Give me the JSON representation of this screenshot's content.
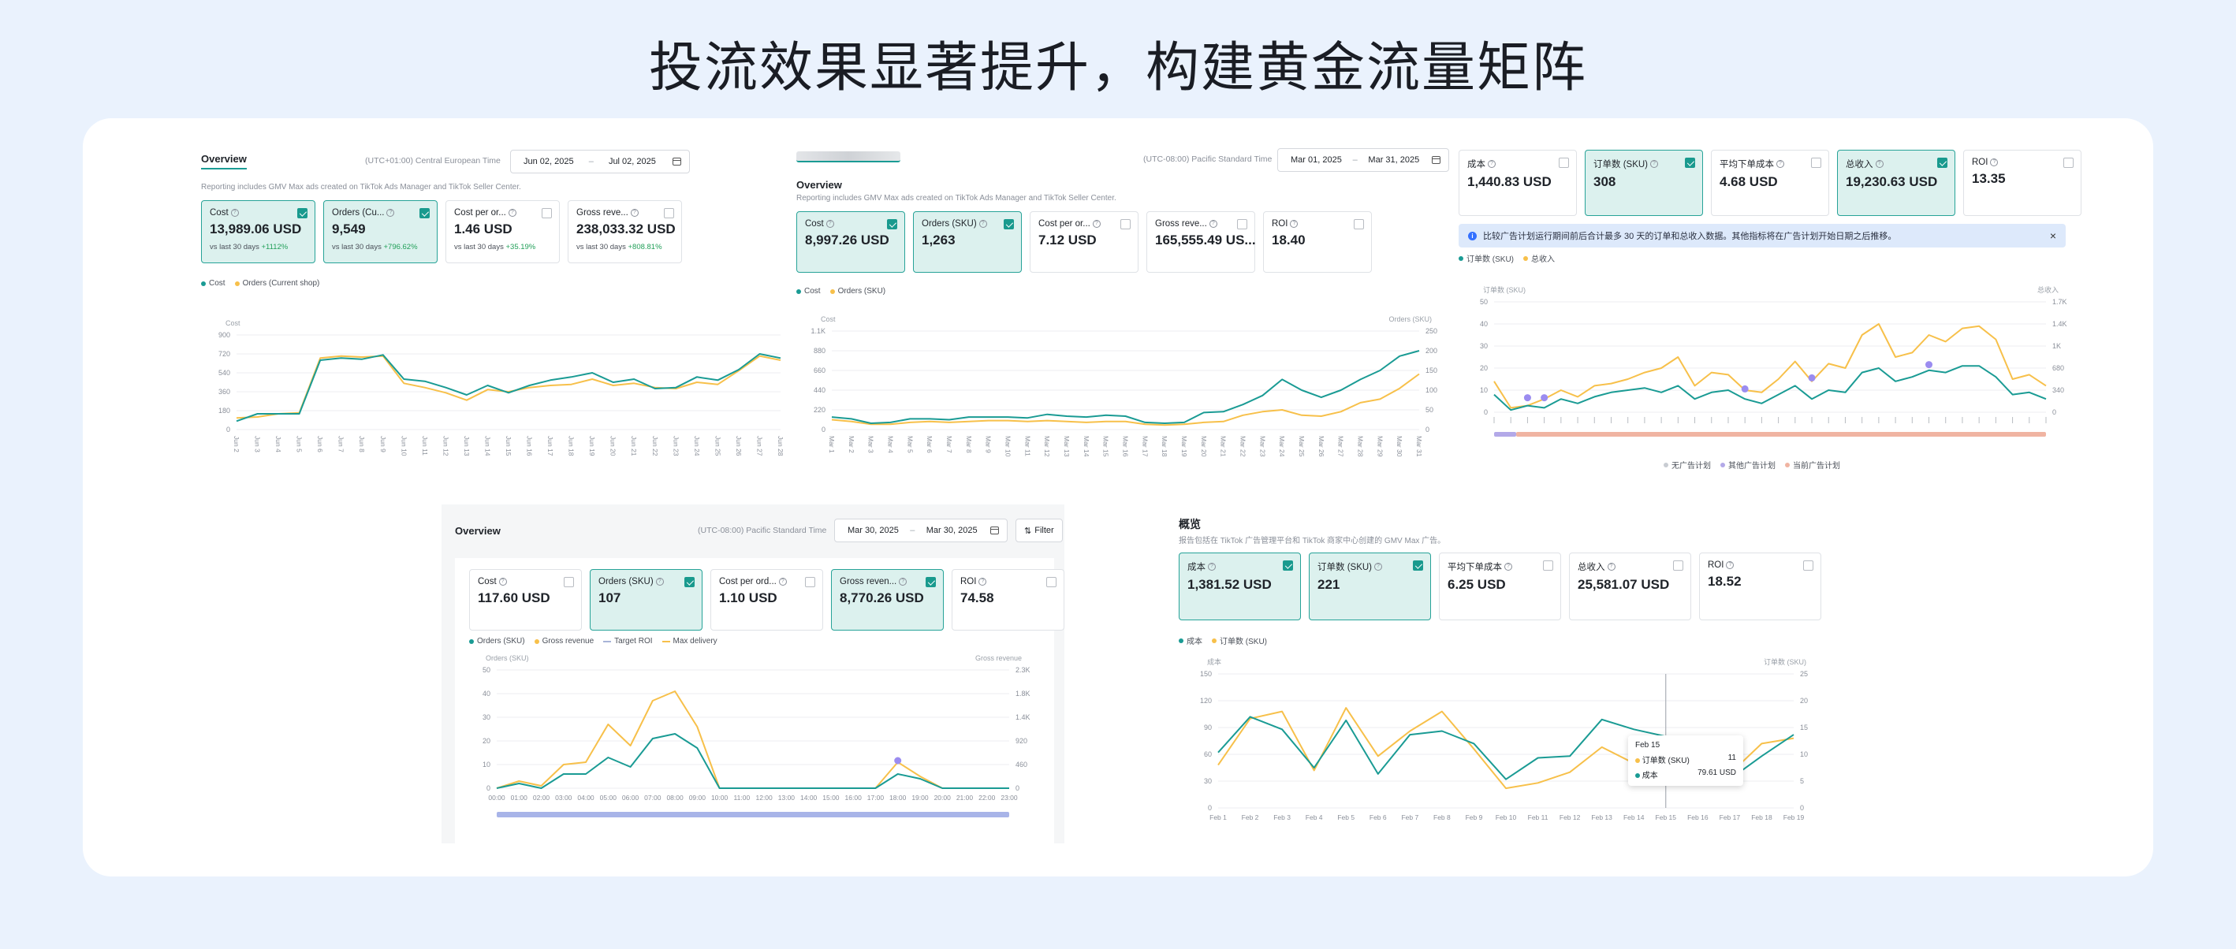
{
  "headline": "投流效果显著提升，构建黄金流量矩阵",
  "colors": {
    "teal": "#1a9b94",
    "orange": "#f7c04a",
    "selected_bg": "#dcf1ee",
    "page_bg": "#eaf2fd"
  },
  "panel1": {
    "tab": "Overview",
    "timezone": "(UTC+01:00) Central European Time",
    "date_start": "Jun 02, 2025",
    "date_end": "Jul 02, 2025",
    "note": "Reporting includes GMV Max ads created on TikTok Ads Manager and TikTok Seller Center.",
    "metrics": [
      {
        "label": "Cost",
        "value": "13,989.06 USD",
        "cmp": "vs last 30 days",
        "chg": "+1112%",
        "selected": true
      },
      {
        "label": "Orders (Cu...",
        "value": "9,549",
        "cmp": "vs last 30 days",
        "chg": "+796.62%",
        "selected": true
      },
      {
        "label": "Cost per or...",
        "value": "1.46 USD",
        "cmp": "vs last 30 days",
        "chg": "+35.19%",
        "selected": false
      },
      {
        "label": "Gross reve...",
        "value": "238,033.32 USD",
        "cmp": "vs last 30 days",
        "chg": "+808.81%",
        "selected": false
      }
    ],
    "legend": [
      "Cost",
      "Orders (Current shop)"
    ],
    "chart_data": {
      "type": "line",
      "ylabel": "Cost",
      "yticks": [
        "900",
        "720",
        "540",
        "360",
        "180",
        "0"
      ],
      "ylim": [
        0,
        900
      ],
      "x": [
        "Jun 2",
        "Jun 3",
        "Jun 4",
        "Jun 5",
        "Jun 6",
        "Jun 7",
        "Jun 8",
        "Jun 9",
        "Jun 10",
        "Jun 11",
        "Jun 12",
        "Jun 13",
        "Jun 14",
        "Jun 15",
        "Jun 16",
        "Jun 17",
        "Jun 18",
        "Jun 19",
        "Jun 20",
        "Jun 21",
        "Jun 22",
        "Jun 23",
        "Jun 24",
        "Jun 25",
        "Jun 26",
        "Jun 27",
        "Jun 28"
      ],
      "series": [
        {
          "name": "Cost",
          "color": "#1a9b94",
          "values": [
            80,
            150,
            150,
            150,
            660,
            680,
            670,
            710,
            480,
            460,
            400,
            330,
            420,
            350,
            420,
            470,
            500,
            540,
            450,
            480,
            390,
            400,
            500,
            470,
            570,
            720,
            680
          ]
        },
        {
          "name": "Orders (Current shop)",
          "color": "#f7c04a",
          "values": [
            110,
            120,
            150,
            160,
            680,
            700,
            690,
            700,
            440,
            400,
            350,
            280,
            380,
            360,
            400,
            420,
            430,
            480,
            420,
            440,
            400,
            390,
            450,
            430,
            560,
            700,
            660
          ]
        }
      ]
    }
  },
  "panel2": {
    "tab": "",
    "timezone": "(UTC-08:00) Pacific Standard Time",
    "date_start": "Mar 01, 2025",
    "date_end": "Mar 31, 2025",
    "title": "Overview",
    "note": "Reporting includes GMV Max ads created on TikTok Ads Manager and TikTok Seller Center.",
    "metrics": [
      {
        "label": "Cost",
        "value": "8,997.26 USD",
        "selected": true
      },
      {
        "label": "Orders (SKU)",
        "value": "1,263",
        "selected": true
      },
      {
        "label": "Cost per or...",
        "value": "7.12 USD",
        "selected": false
      },
      {
        "label": "Gross reve...",
        "value": "165,555.49 US...",
        "selected": false
      },
      {
        "label": "ROI",
        "value": "18.40",
        "selected": false
      }
    ],
    "legend": [
      "Cost",
      "Orders (SKU)"
    ],
    "chart_data": {
      "type": "line",
      "ylabel": "Cost",
      "y2label": "Orders (SKU)",
      "yticks": [
        "1.1K",
        "880",
        "660",
        "440",
        "220",
        "0"
      ],
      "y2ticks": [
        "250",
        "200",
        "150",
        "100",
        "50",
        "0"
      ],
      "ylim": [
        0,
        1100
      ],
      "x": [
        "Mar 1",
        "Mar 2",
        "Mar 3",
        "Mar 4",
        "Mar 5",
        "Mar 6",
        "Mar 7",
        "Mar 8",
        "Mar 9",
        "Mar 10",
        "Mar 11",
        "Mar 12",
        "Mar 13",
        "Mar 14",
        "Mar 15",
        "Mar 16",
        "Mar 17",
        "Mar 18",
        "Mar 19",
        "Mar 20",
        "Mar 21",
        "Mar 22",
        "Mar 23",
        "Mar 24",
        "Mar 25",
        "Mar 26",
        "Mar 27",
        "Mar 28",
        "Mar 29",
        "Mar 30",
        "Mar 31"
      ],
      "series": [
        {
          "name": "Cost",
          "color": "#1a9b94",
          "values": [
            140,
            120,
            70,
            80,
            120,
            120,
            110,
            140,
            140,
            140,
            130,
            170,
            150,
            140,
            160,
            150,
            80,
            70,
            80,
            190,
            200,
            280,
            380,
            560,
            440,
            360,
            440,
            560,
            660,
            820,
            880
          ]
        },
        {
          "name": "Orders (SKU)",
          "color": "#f7c04a",
          "values": [
            110,
            90,
            60,
            60,
            80,
            90,
            80,
            90,
            100,
            100,
            90,
            100,
            90,
            80,
            90,
            90,
            60,
            50,
            60,
            80,
            90,
            160,
            200,
            220,
            160,
            150,
            200,
            300,
            340,
            460,
            620
          ]
        }
      ]
    }
  },
  "panel3": {
    "metrics": [
      {
        "label": "成本",
        "value": "1,440.83 USD",
        "selected": false
      },
      {
        "label": "订单数 (SKU)",
        "value": "308",
        "selected": true
      },
      {
        "label": "平均下单成本",
        "value": "4.68 USD",
        "selected": false
      },
      {
        "label": "总收入",
        "value": "19,230.63 USD",
        "selected": true
      },
      {
        "label": "ROI",
        "value": "13.35",
        "selected": false
      }
    ],
    "info": "比较广告计划运行期间前后合计最多 30 天的订单和总收入数据。其他指标将在广告计划开始日期之后推移。",
    "legend": [
      "订单数 (SKU)",
      "总收入"
    ],
    "bottom_legend": [
      "无广告计划",
      "其他广告计划",
      "当前广告计划"
    ],
    "chart_data": {
      "type": "line",
      "ylabel": "订单数 (SKU)",
      "y2label": "总收入",
      "yticks": [
        "50",
        "40",
        "30",
        "20",
        "10",
        "0"
      ],
      "y2ticks": [
        "1.7K",
        "1.4K",
        "1K",
        "680",
        "340",
        "0"
      ],
      "ylim": [
        0,
        50
      ],
      "series": [
        {
          "name": "订单数 (SKU)",
          "color": "#1a9b94",
          "values": [
            8,
            1,
            3,
            2,
            6,
            4,
            7,
            9,
            10,
            11,
            9,
            12,
            6,
            9,
            10,
            6,
            4,
            8,
            12,
            6,
            10,
            9,
            18,
            20,
            14,
            16,
            19,
            18,
            21,
            21,
            16,
            8,
            9,
            6
          ]
        },
        {
          "name": "总收入",
          "color": "#f7c04a",
          "values": [
            14,
            2,
            3,
            6,
            10,
            7,
            12,
            13,
            15,
            18,
            20,
            25,
            12,
            18,
            17,
            10,
            9,
            15,
            23,
            14,
            22,
            20,
            35,
            40,
            25,
            27,
            35,
            32,
            38,
            39,
            33,
            15,
            17,
            12
          ]
        }
      ]
    }
  },
  "panel4": {
    "title": "Overview",
    "timezone": "(UTC-08:00) Pacific Standard Time",
    "date_start": "Mar 30, 2025",
    "date_end": "Mar 30, 2025",
    "filter": "Filter",
    "metrics": [
      {
        "label": "Cost",
        "value": "117.60 USD",
        "selected": false
      },
      {
        "label": "Orders (SKU)",
        "value": "107",
        "selected": true
      },
      {
        "label": "Cost per ord...",
        "value": "1.10 USD",
        "selected": false
      },
      {
        "label": "Gross reven...",
        "value": "8,770.26 USD",
        "selected": true
      },
      {
        "label": "ROI",
        "value": "74.58",
        "selected": false
      }
    ],
    "legend": [
      "Orders (SKU)",
      "Gross revenue",
      "Target ROI",
      "Max delivery"
    ],
    "chart_data": {
      "type": "line",
      "ylabel": "Orders (SKU)",
      "y2label": "Gross revenue",
      "yticks": [
        "50",
        "40",
        "30",
        "20",
        "10",
        "0"
      ],
      "y2ticks": [
        "2.3K",
        "1.8K",
        "1.4K",
        "920",
        "460",
        "0"
      ],
      "ylim": [
        0,
        50
      ],
      "x": [
        "00:00",
        "01:00",
        "02:00",
        "03:00",
        "04:00",
        "05:00",
        "06:00",
        "07:00",
        "08:00",
        "09:00",
        "10:00",
        "11:00",
        "12:00",
        "13:00",
        "14:00",
        "15:00",
        "16:00",
        "17:00",
        "18:00",
        "19:00",
        "20:00",
        "21:00",
        "22:00",
        "23:00"
      ],
      "series": [
        {
          "name": "Orders (SKU)",
          "color": "#1a9b94",
          "values": [
            0,
            2,
            0,
            6,
            6,
            13,
            9,
            21,
            23,
            17,
            0,
            0,
            0,
            0,
            0,
            0,
            0,
            0,
            6,
            4,
            0,
            0,
            0,
            0
          ]
        },
        {
          "name": "Gross revenue",
          "color": "#f7c04a",
          "values": [
            0,
            3,
            1,
            10,
            11,
            27,
            18,
            37,
            41,
            26,
            0,
            0,
            0,
            0,
            0,
            0,
            0,
            0,
            11,
            5,
            0,
            0,
            0,
            0
          ]
        }
      ]
    }
  },
  "panel5": {
    "title": "概览",
    "note": "报告包括在 TikTok 广告管理平台和 TikTok 商家中心创建的 GMV Max 广告。",
    "metrics": [
      {
        "label": "成本",
        "value": "1,381.52 USD",
        "selected": true
      },
      {
        "label": "订单数 (SKU)",
        "value": "221",
        "selected": true
      },
      {
        "label": "平均下单成本",
        "value": "6.25 USD",
        "selected": false
      },
      {
        "label": "总收入",
        "value": "25,581.07 USD",
        "selected": false
      },
      {
        "label": "ROI",
        "value": "18.52",
        "selected": false
      }
    ],
    "legend": [
      "成本",
      "订单数 (SKU)"
    ],
    "tooltip": {
      "date": "Feb 15",
      "rows": [
        {
          "label": "订单数 (SKU)",
          "value": "11"
        },
        {
          "label": "成本",
          "value": "79.61 USD"
        }
      ]
    },
    "chart_data": {
      "type": "line",
      "ylabel": "成本",
      "y2label": "订单数 (SKU)",
      "yticks": [
        "150",
        "120",
        "90",
        "60",
        "30",
        "0"
      ],
      "y2ticks": [
        "25",
        "20",
        "15",
        "10",
        "5",
        "0"
      ],
      "ylim": [
        0,
        150
      ],
      "x": [
        "Feb 1",
        "Feb 2",
        "Feb 3",
        "Feb 4",
        "Feb 5",
        "Feb 6",
        "Feb 7",
        "Feb 8",
        "Feb 9",
        "Feb 10",
        "Feb 11",
        "Feb 12",
        "Feb 13",
        "Feb 14",
        "Feb 15",
        "Feb 16",
        "Feb 17",
        "Feb 18",
        "Feb 19"
      ],
      "series": [
        {
          "name": "成本",
          "color": "#1a9b94",
          "values": [
            62,
            102,
            88,
            45,
            98,
            38,
            82,
            86,
            72,
            32,
            56,
            58,
            99,
            88,
            80,
            75,
            32,
            58,
            82
          ]
        },
        {
          "name": "订单数 (SKU)",
          "color": "#f7c04a",
          "values": [
            48,
            100,
            108,
            42,
            112,
            58,
            86,
            108,
            66,
            22,
            28,
            40,
            68,
            50,
            55,
            68,
            38,
            72,
            78
          ]
        }
      ]
    }
  }
}
